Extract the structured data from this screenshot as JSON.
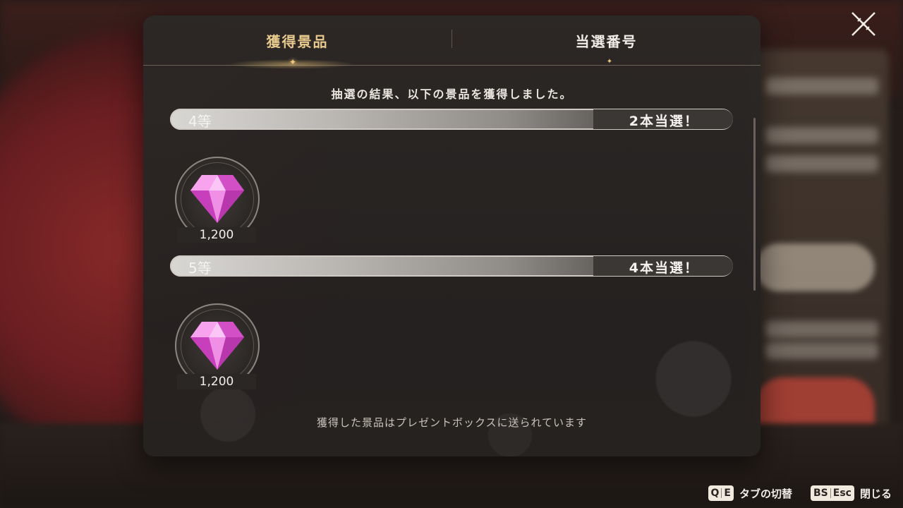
{
  "tabs": [
    {
      "label": "獲得景品",
      "active": true
    },
    {
      "label": "当選番号",
      "active": false
    }
  ],
  "headline": "抽選の結果、以下の景品を獲得しました。",
  "tiers": [
    {
      "name": "4等",
      "count": "2本当選！",
      "prizes": [
        {
          "icon": "gem-icon",
          "quantity": "1,200"
        }
      ]
    },
    {
      "name": "5等",
      "count": "4本当選！",
      "prizes": [
        {
          "icon": "gem-icon",
          "quantity": "1,200"
        }
      ]
    }
  ],
  "footer_note": "獲得した景品はプレゼントボックスに送られています",
  "hints": [
    {
      "keys": [
        "Q",
        "E"
      ],
      "label": "タブの切替"
    },
    {
      "keys": [
        "BS",
        "Esc"
      ],
      "label": "閉じる"
    }
  ],
  "colors": {
    "active_tab": "#e7c98d",
    "gem": "#e46ad8",
    "curtain": "#8c2a2a"
  }
}
